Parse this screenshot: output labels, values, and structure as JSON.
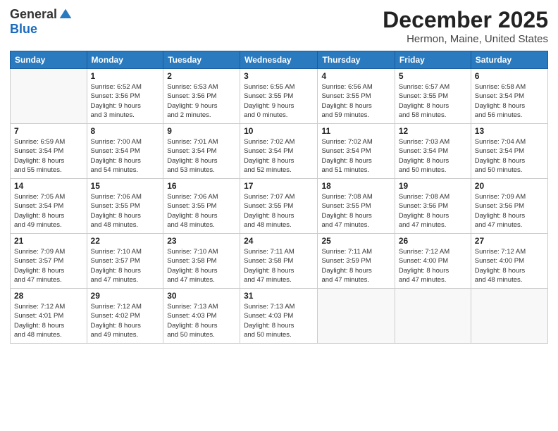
{
  "logo": {
    "general": "General",
    "blue": "Blue"
  },
  "title": {
    "month": "December 2025",
    "location": "Hermon, Maine, United States"
  },
  "weekdays": [
    "Sunday",
    "Monday",
    "Tuesday",
    "Wednesday",
    "Thursday",
    "Friday",
    "Saturday"
  ],
  "weeks": [
    [
      {
        "day": "",
        "info": ""
      },
      {
        "day": "1",
        "info": "Sunrise: 6:52 AM\nSunset: 3:56 PM\nDaylight: 9 hours\nand 3 minutes."
      },
      {
        "day": "2",
        "info": "Sunrise: 6:53 AM\nSunset: 3:56 PM\nDaylight: 9 hours\nand 2 minutes."
      },
      {
        "day": "3",
        "info": "Sunrise: 6:55 AM\nSunset: 3:55 PM\nDaylight: 9 hours\nand 0 minutes."
      },
      {
        "day": "4",
        "info": "Sunrise: 6:56 AM\nSunset: 3:55 PM\nDaylight: 8 hours\nand 59 minutes."
      },
      {
        "day": "5",
        "info": "Sunrise: 6:57 AM\nSunset: 3:55 PM\nDaylight: 8 hours\nand 58 minutes."
      },
      {
        "day": "6",
        "info": "Sunrise: 6:58 AM\nSunset: 3:54 PM\nDaylight: 8 hours\nand 56 minutes."
      }
    ],
    [
      {
        "day": "7",
        "info": "Sunrise: 6:59 AM\nSunset: 3:54 PM\nDaylight: 8 hours\nand 55 minutes."
      },
      {
        "day": "8",
        "info": "Sunrise: 7:00 AM\nSunset: 3:54 PM\nDaylight: 8 hours\nand 54 minutes."
      },
      {
        "day": "9",
        "info": "Sunrise: 7:01 AM\nSunset: 3:54 PM\nDaylight: 8 hours\nand 53 minutes."
      },
      {
        "day": "10",
        "info": "Sunrise: 7:02 AM\nSunset: 3:54 PM\nDaylight: 8 hours\nand 52 minutes."
      },
      {
        "day": "11",
        "info": "Sunrise: 7:02 AM\nSunset: 3:54 PM\nDaylight: 8 hours\nand 51 minutes."
      },
      {
        "day": "12",
        "info": "Sunrise: 7:03 AM\nSunset: 3:54 PM\nDaylight: 8 hours\nand 50 minutes."
      },
      {
        "day": "13",
        "info": "Sunrise: 7:04 AM\nSunset: 3:54 PM\nDaylight: 8 hours\nand 50 minutes."
      }
    ],
    [
      {
        "day": "14",
        "info": "Sunrise: 7:05 AM\nSunset: 3:54 PM\nDaylight: 8 hours\nand 49 minutes."
      },
      {
        "day": "15",
        "info": "Sunrise: 7:06 AM\nSunset: 3:55 PM\nDaylight: 8 hours\nand 48 minutes."
      },
      {
        "day": "16",
        "info": "Sunrise: 7:06 AM\nSunset: 3:55 PM\nDaylight: 8 hours\nand 48 minutes."
      },
      {
        "day": "17",
        "info": "Sunrise: 7:07 AM\nSunset: 3:55 PM\nDaylight: 8 hours\nand 48 minutes."
      },
      {
        "day": "18",
        "info": "Sunrise: 7:08 AM\nSunset: 3:55 PM\nDaylight: 8 hours\nand 47 minutes."
      },
      {
        "day": "19",
        "info": "Sunrise: 7:08 AM\nSunset: 3:56 PM\nDaylight: 8 hours\nand 47 minutes."
      },
      {
        "day": "20",
        "info": "Sunrise: 7:09 AM\nSunset: 3:56 PM\nDaylight: 8 hours\nand 47 minutes."
      }
    ],
    [
      {
        "day": "21",
        "info": "Sunrise: 7:09 AM\nSunset: 3:57 PM\nDaylight: 8 hours\nand 47 minutes."
      },
      {
        "day": "22",
        "info": "Sunrise: 7:10 AM\nSunset: 3:57 PM\nDaylight: 8 hours\nand 47 minutes."
      },
      {
        "day": "23",
        "info": "Sunrise: 7:10 AM\nSunset: 3:58 PM\nDaylight: 8 hours\nand 47 minutes."
      },
      {
        "day": "24",
        "info": "Sunrise: 7:11 AM\nSunset: 3:58 PM\nDaylight: 8 hours\nand 47 minutes."
      },
      {
        "day": "25",
        "info": "Sunrise: 7:11 AM\nSunset: 3:59 PM\nDaylight: 8 hours\nand 47 minutes."
      },
      {
        "day": "26",
        "info": "Sunrise: 7:12 AM\nSunset: 4:00 PM\nDaylight: 8 hours\nand 47 minutes."
      },
      {
        "day": "27",
        "info": "Sunrise: 7:12 AM\nSunset: 4:00 PM\nDaylight: 8 hours\nand 48 minutes."
      }
    ],
    [
      {
        "day": "28",
        "info": "Sunrise: 7:12 AM\nSunset: 4:01 PM\nDaylight: 8 hours\nand 48 minutes."
      },
      {
        "day": "29",
        "info": "Sunrise: 7:12 AM\nSunset: 4:02 PM\nDaylight: 8 hours\nand 49 minutes."
      },
      {
        "day": "30",
        "info": "Sunrise: 7:13 AM\nSunset: 4:03 PM\nDaylight: 8 hours\nand 50 minutes."
      },
      {
        "day": "31",
        "info": "Sunrise: 7:13 AM\nSunset: 4:03 PM\nDaylight: 8 hours\nand 50 minutes."
      },
      {
        "day": "",
        "info": ""
      },
      {
        "day": "",
        "info": ""
      },
      {
        "day": "",
        "info": ""
      }
    ]
  ]
}
